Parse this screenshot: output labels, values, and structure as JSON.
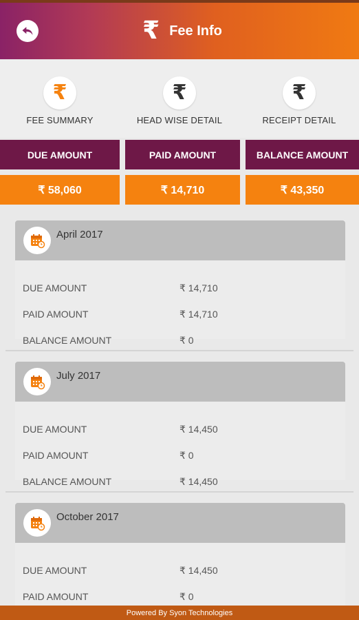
{
  "header": {
    "title": "Fee Info",
    "back_icon": "back-arrow-icon",
    "title_icon": "rupee-icon"
  },
  "tabs": [
    {
      "label": "FEE SUMMARY",
      "icon": "rupee-icon",
      "color": "#f5820f"
    },
    {
      "label": "HEAD WISE DETAIL",
      "icon": "rupee-icon",
      "color": "#333333"
    },
    {
      "label": "RECEIPT DETAIL",
      "icon": "rupee-icon",
      "color": "#333333"
    }
  ],
  "summary": {
    "due": {
      "label": "DUE AMOUNT",
      "value": "₹ 58,060"
    },
    "paid": {
      "label": "PAID AMOUNT",
      "value": "₹ 14,710"
    },
    "balance": {
      "label": "BALANCE AMOUNT",
      "value": "₹ 43,350"
    }
  },
  "installments": [
    {
      "title": "April 2017",
      "rows": [
        {
          "label": "DUE AMOUNT",
          "value": "₹ 14,710"
        },
        {
          "label": "PAID AMOUNT",
          "value": "₹ 14,710"
        },
        {
          "label": "BALANCE AMOUNT",
          "value": "₹ 0"
        }
      ]
    },
    {
      "title": "July 2017",
      "rows": [
        {
          "label": "DUE AMOUNT",
          "value": "₹ 14,450"
        },
        {
          "label": "PAID AMOUNT",
          "value": "₹ 0"
        },
        {
          "label": "BALANCE AMOUNT",
          "value": "₹ 14,450"
        }
      ]
    },
    {
      "title": "October 2017",
      "rows": [
        {
          "label": "DUE AMOUNT",
          "value": "₹ 14,450"
        },
        {
          "label": "PAID AMOUNT",
          "value": "₹ 0"
        }
      ]
    }
  ],
  "footer": {
    "text": "Powered By Syon Technologies"
  },
  "colors": {
    "primary_purple": "#6e1847",
    "primary_orange": "#f5820f"
  }
}
